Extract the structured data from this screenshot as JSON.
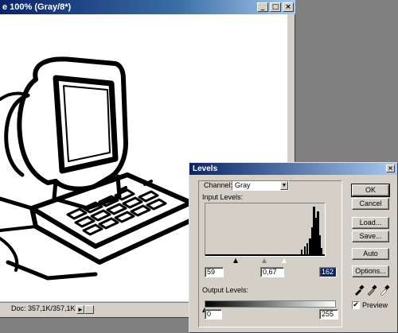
{
  "document": {
    "title": "e 100% (Gray/8*)",
    "minimize_label": "_",
    "maximize_label": "□",
    "close_label": "×",
    "status_text": "Doc: 357,1K/357,1K",
    "scroll_arrow": "►"
  },
  "levels": {
    "title": "Levels",
    "close_label": "×",
    "channel_label": "Channel:",
    "channel_value": "Gray",
    "input_levels_label": "Input Levels:",
    "input_black": "59",
    "input_gamma": "0,67",
    "input_white": "162",
    "output_levels_label": "Output Levels:",
    "output_black": "0",
    "output_white": "255",
    "buttons": {
      "ok": "OK",
      "cancel": "Cancel",
      "load": "Load...",
      "save": "Save...",
      "auto": "Auto",
      "options": "Options..."
    },
    "preview_label": "Preview",
    "preview_checked": "✔"
  },
  "icons": {
    "black_eyedropper": "eyedropper-black-icon",
    "gray_eyedropper": "eyedropper-gray-icon",
    "white_eyedropper": "eyedropper-white-icon"
  }
}
